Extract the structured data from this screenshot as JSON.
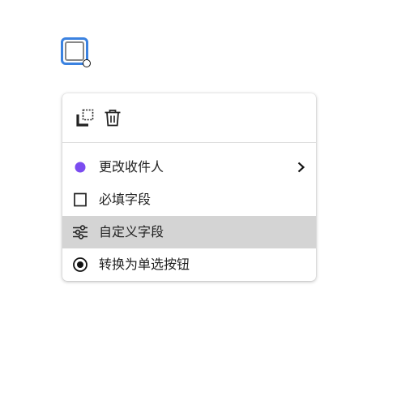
{
  "field": {
    "type": "checkbox",
    "selected": true
  },
  "menu": {
    "toolbar": {
      "copy_icon": "copy-icon",
      "delete_icon": "trash-icon"
    },
    "items": [
      {
        "label": "更改收件人",
        "icon": "dot-icon",
        "icon_color": "#7b4cf0",
        "has_submenu": true
      },
      {
        "label": "必填字段",
        "icon": "checkbox-icon",
        "has_submenu": false
      },
      {
        "label": "自定义字段",
        "icon": "sliders-icon",
        "highlighted": true,
        "has_submenu": false
      },
      {
        "label": "转换为单选按钮",
        "icon": "radio-icon",
        "has_submenu": false
      }
    ]
  },
  "colors": {
    "selection": "#3b82e0",
    "recipient": "#7b4cf0",
    "highlight": "#d4d4d4"
  }
}
